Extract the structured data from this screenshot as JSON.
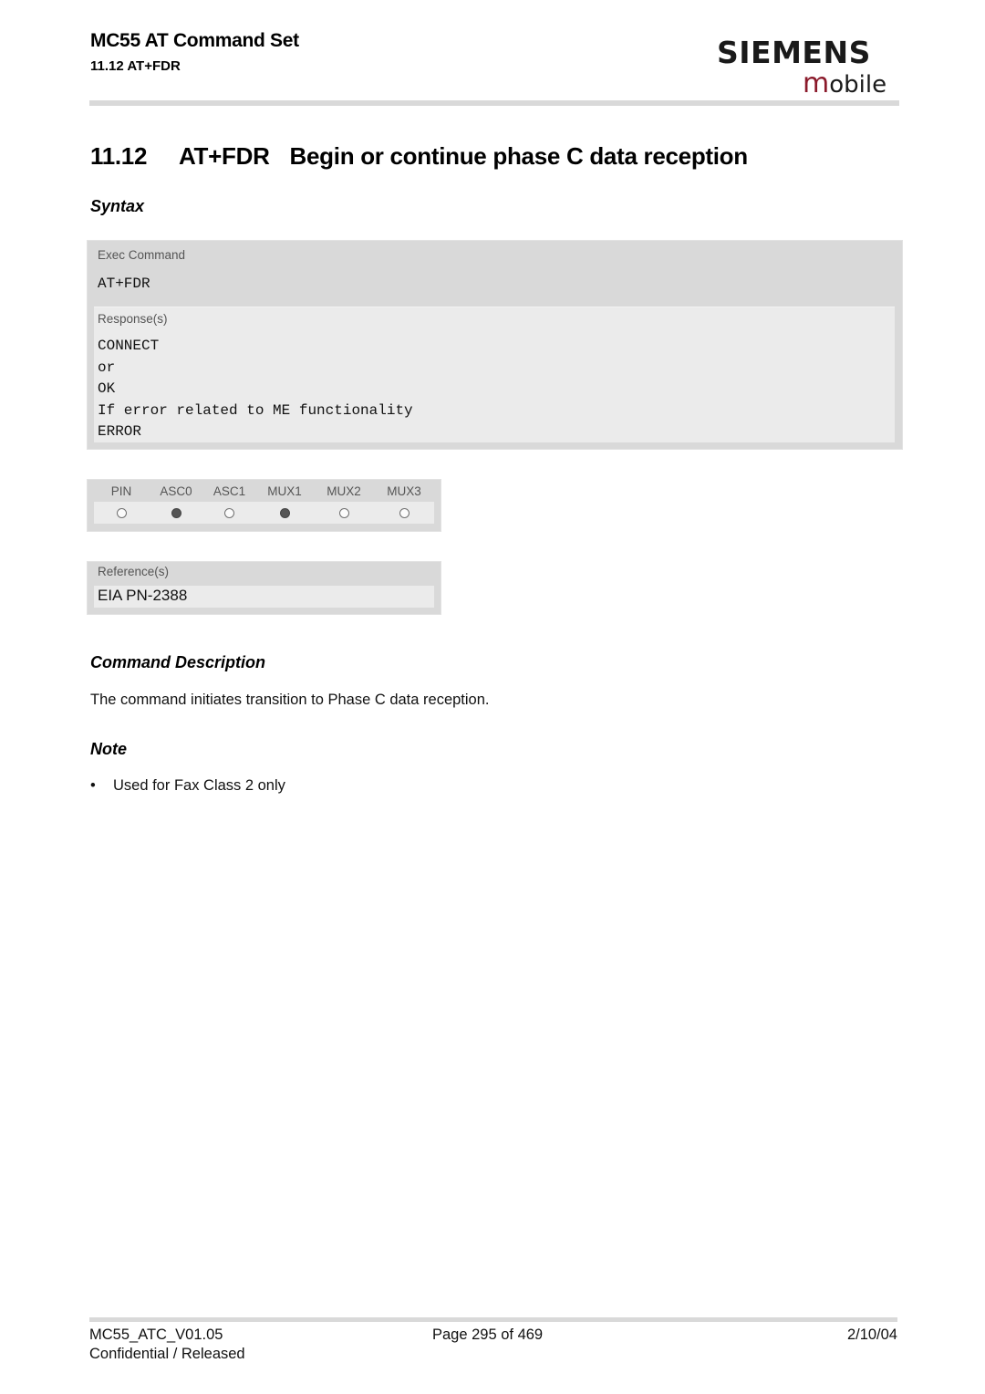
{
  "header": {
    "doc_title": "MC55 AT Command Set",
    "section_ref": "11.12 AT+FDR",
    "logo_brand": "SIEMENS",
    "logo_sub_initial": "m",
    "logo_sub_rest": "obile",
    "logo_accent_color": "#8b1a2b"
  },
  "heading": {
    "number": "11.12",
    "command": "AT+FDR",
    "title": "Begin or continue phase C data reception"
  },
  "syntax": {
    "section_label": "Syntax",
    "exec_label": "Exec Command",
    "exec_command": "AT+FDR",
    "responses_label": "Response(s)",
    "responses": [
      "CONNECT",
      "or",
      "OK",
      "If error related to ME functionality",
      "ERROR"
    ]
  },
  "pins": {
    "headers": [
      "PIN",
      "ASC0",
      "ASC1",
      "MUX1",
      "MUX2",
      "MUX3"
    ],
    "supported": [
      false,
      true,
      false,
      true,
      false,
      false
    ]
  },
  "references": {
    "label": "Reference(s)",
    "value": "EIA PN-2388"
  },
  "description": {
    "section_label": "Command Description",
    "text": "The command initiates transition to Phase C data reception."
  },
  "note": {
    "section_label": "Note",
    "bullet_char": "•",
    "items": [
      "Used for Fax Class 2 only"
    ]
  },
  "footer": {
    "doc_id": "MC55_ATC_V01.05",
    "page": "Page 295 of 469",
    "date": "2/10/04",
    "status": "Confidential / Released"
  }
}
